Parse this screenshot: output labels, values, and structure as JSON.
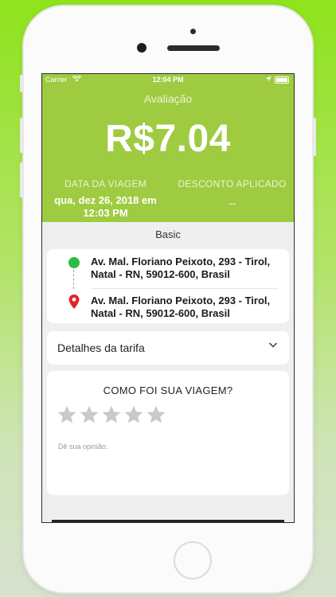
{
  "status_bar": {
    "carrier": "Carrier",
    "time": "12:04 PM"
  },
  "header": {
    "title": "Avaliação",
    "price": "R$7.04",
    "trip_date_label": "DATA DA VIAGEM",
    "trip_date_line1": "qua, dez 26, 2018 em",
    "trip_date_line2": "12:03 PM",
    "discount_label": "DESCONTO APLICADO",
    "discount_value": "--",
    "background_color": "#9fcb41"
  },
  "category": "Basic",
  "route": {
    "origin_line1": "Av. Mal. Floriano Peixoto,  293 - Tirol,",
    "origin_line2": "Natal - RN,  59012-600,  Brasil",
    "destination_line1": "Av. Mal. Floriano Peixoto,  293 - Tirol,",
    "destination_line2": "Natal - RN,  59012-600,  Brasil",
    "origin_icon": "green-dot-icon",
    "destination_icon": "red-pin-icon"
  },
  "fare_details": {
    "label": "Detalhes da tarifa",
    "icon": "chevron-down-icon"
  },
  "rating": {
    "question": "COMO FOI SUA VIAGEM?",
    "stars_total": 5,
    "stars_selected": 0,
    "opinion_placeholder": "Dê sua opinião."
  }
}
